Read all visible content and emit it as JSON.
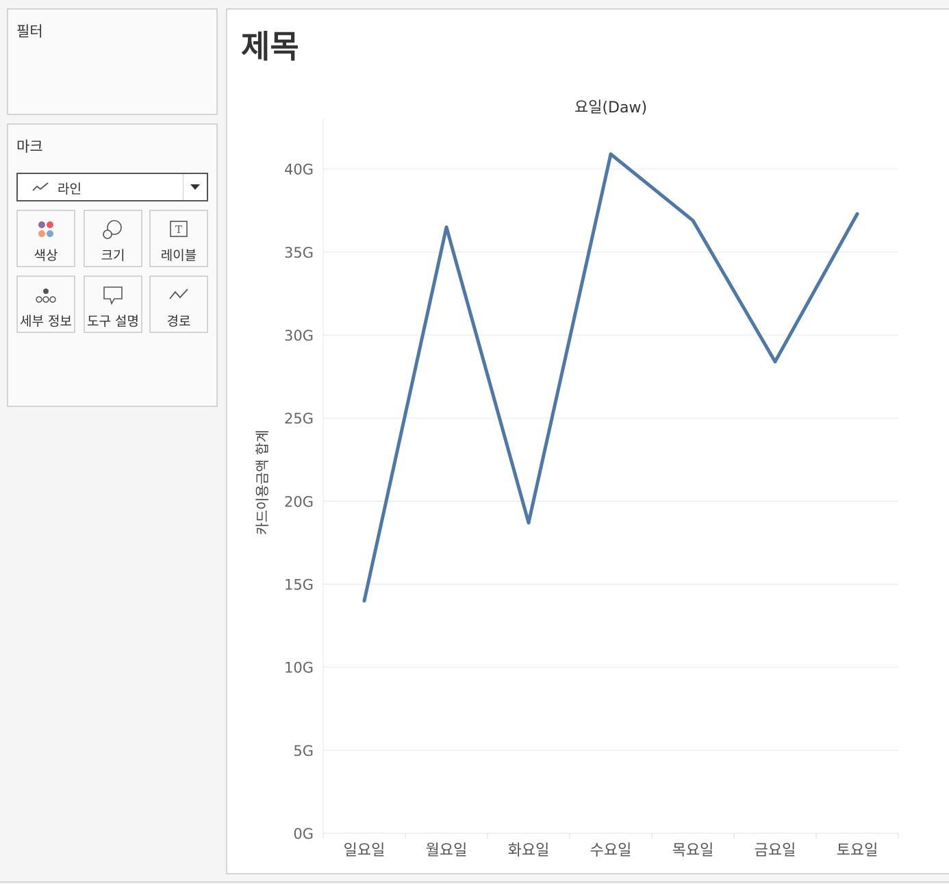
{
  "filters": {
    "title": "필터"
  },
  "marks": {
    "title": "마크",
    "mark_type": {
      "label": "라인",
      "icon": "line-chart-icon"
    },
    "buttons": [
      {
        "label": "색상",
        "icon": "color-icon"
      },
      {
        "label": "크기",
        "icon": "size-icon"
      },
      {
        "label": "레이블",
        "icon": "label-icon",
        "glyph": "T"
      },
      {
        "label": "세부 정보",
        "icon": "detail-icon"
      },
      {
        "label": "도구 설명",
        "icon": "tooltip-icon"
      },
      {
        "label": "경로",
        "icon": "path-icon"
      }
    ],
    "palette": [
      "#8e6a9e",
      "#f0556a",
      "#f29e6a",
      "#7ea6cc"
    ]
  },
  "sheet": {
    "title": "제목"
  },
  "chart_data": {
    "type": "line",
    "title": "요일(Daw)",
    "xlabel": "",
    "ylabel": "카드이용금액 합계",
    "categories": [
      "일요일",
      "월요일",
      "화요일",
      "수요일",
      "목요일",
      "금요일",
      "토요일"
    ],
    "series": [
      {
        "values": [
          14.0,
          36.5,
          18.7,
          40.9,
          36.9,
          28.4,
          37.3
        ]
      }
    ],
    "ylim": [
      0,
      43
    ],
    "yticks": [
      0,
      5,
      10,
      15,
      20,
      25,
      30,
      35,
      40
    ],
    "tick_suffix": "G",
    "line_color": "#4e79a7",
    "grid": true
  }
}
